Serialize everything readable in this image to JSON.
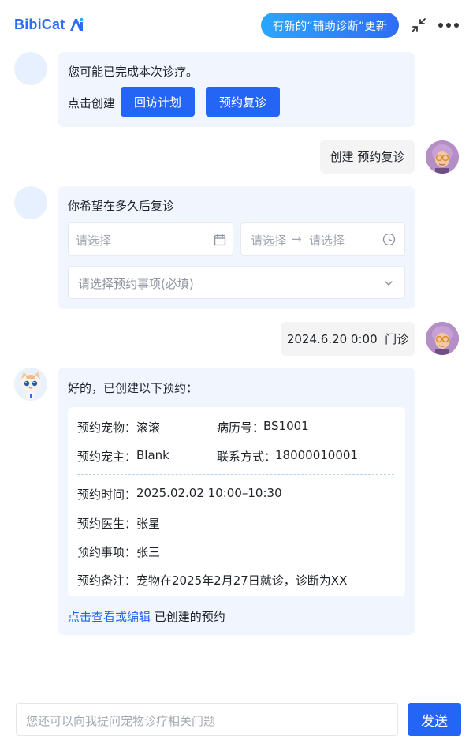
{
  "header": {
    "brand": "BibiCat",
    "update_pill": "有新的“辅助诊断”更新",
    "collapse_icon": "collapse-arrows-icon",
    "more_icon": "more-dots-icon"
  },
  "messages": {
    "m1": {
      "text": "您可能已完成本次诊疗。",
      "prompt": "点击创建",
      "btn_followup": "回访计划",
      "btn_revisit": "预约复诊"
    },
    "u1": {
      "text": "创建 预约复诊"
    },
    "m2": {
      "text": "你希望在多久后复诊",
      "date_placeholder": "请选择",
      "time_start_placeholder": "请选择",
      "time_arrow": "→",
      "time_end_placeholder": "请选择",
      "item_placeholder": "请选择预约事项(必填)"
    },
    "u2": {
      "text": "2024.6.20 0:00  门诊"
    },
    "m3": {
      "text": "好的，已创建以下预约：",
      "card": {
        "pet_label": "预约宠物：",
        "pet_value": "滚滚",
        "record_label": "病历号：",
        "record_value": "BS1001",
        "owner_label": "预约宠主：",
        "owner_value": "Blank",
        "contact_label": "联系方式：",
        "contact_value": "18000010001",
        "time_label": "预约时间：",
        "time_value": "2025.02.02 10:00–10:30",
        "doctor_label": "预约医生：",
        "doctor_value": "张星",
        "item_label": "预约事项：",
        "item_value": "张三",
        "note_label": "预约备注：",
        "note_value": "宠物在2025年2月27日就诊，诊断为XX"
      },
      "link_text": "点击查看或编辑",
      "link_suffix": "已创建的预约"
    }
  },
  "composer": {
    "placeholder": "您还可以向我提问宠物诊疗相关问题",
    "send_label": "发送"
  },
  "colors": {
    "accent": "#2465f5",
    "bubble_bg": "#f1f6fe",
    "user_bubble_bg": "#f4f4f5"
  }
}
